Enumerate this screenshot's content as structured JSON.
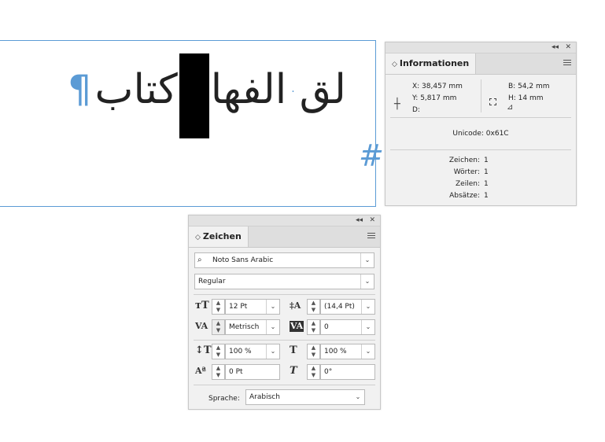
{
  "document": {
    "text_segments": [
      "لق",
      "الفها",
      "كتاب"
    ],
    "pilcrow": "¶",
    "space_marker": "·",
    "frame_marker": "#"
  },
  "info_panel": {
    "title": "Informationen",
    "x": "X: 38,457 mm",
    "y": "Y: 5,817 mm",
    "d": "D:",
    "b": "B: 54,2 mm",
    "h": "H: 14 mm",
    "unicode": "Unicode: 0x61C",
    "stats": [
      {
        "label": "Zeichen:",
        "value": "1"
      },
      {
        "label": "Wörter:",
        "value": "1"
      },
      {
        "label": "Zeilen:",
        "value": "1"
      },
      {
        "label": "Absätze:",
        "value": "1"
      }
    ]
  },
  "char_panel": {
    "title": "Zeichen",
    "font_family": "Noto Sans Arabic",
    "font_style": "Regular",
    "font_size": "12 Pt",
    "leading": "(14,4 Pt)",
    "kerning": "Metrisch",
    "tracking": "0",
    "vertical_scale": "100 %",
    "horizontal_scale": "100 %",
    "baseline_shift": "0 Pt",
    "skew": "0°",
    "language_label": "Sprache:",
    "language": "Arabisch"
  },
  "icons": {
    "collapse": "◂◂",
    "close": "✕",
    "chevron": "⌄",
    "tab_toggle": "◇"
  },
  "colors": {
    "accent_blue": "#5b9bd5",
    "panel_bg": "#f1f1f1"
  }
}
